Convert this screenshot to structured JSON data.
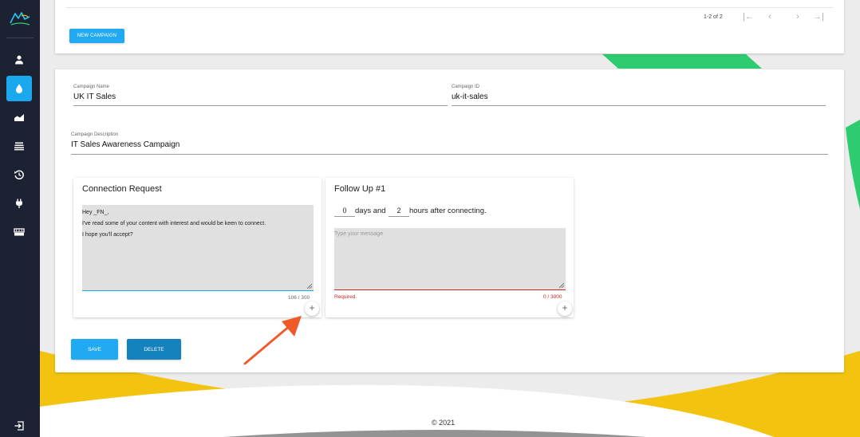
{
  "sidebar": {
    "items": [
      {
        "icon": "person-icon",
        "active": false
      },
      {
        "icon": "drop-icon",
        "active": true
      },
      {
        "icon": "area-chart-icon",
        "active": false
      },
      {
        "icon": "stack-icon",
        "active": false
      },
      {
        "icon": "history-icon",
        "active": false
      },
      {
        "icon": "plug-icon",
        "active": false
      },
      {
        "icon": "storage-icon",
        "active": false
      }
    ],
    "logout_icon": "logout-icon"
  },
  "campaign_list": {
    "pagination": "1-2 of 2",
    "new_campaign_label": "NEW CAMPAIGN"
  },
  "campaign": {
    "name_label": "Campaign Name",
    "name_value": "UK IT Sales",
    "id_label": "Campaign ID",
    "id_value": "uk-it-sales",
    "description_label": "Campaign Description",
    "description_value": "IT Sales Awareness Campaign"
  },
  "connection_request": {
    "title": "Connection Request",
    "line1": "Hey _FN_,",
    "line2": "I've read some of your content with interest and would be keen to connect.",
    "line3": "I hope you'll accept?",
    "counter": "106 / 300"
  },
  "follow_up": {
    "title": "Follow Up #1",
    "days_value": "0",
    "days_label": "days and",
    "hours_value": "2",
    "hours_label": "hours after connecting.",
    "placeholder": "Type your message",
    "required_label": "Required.",
    "counter": "0 / 3000"
  },
  "actions": {
    "save_label": "SAVE",
    "delete_label": "DELETE"
  },
  "footer": {
    "copyright": "© 2021"
  },
  "colors": {
    "sidebar_bg": "#1d2232",
    "accent": "#21a9f1",
    "delete": "#1483bd",
    "error": "#c62828",
    "deco_green": "#2ecc71",
    "deco_yellow": "#f2c40f"
  }
}
